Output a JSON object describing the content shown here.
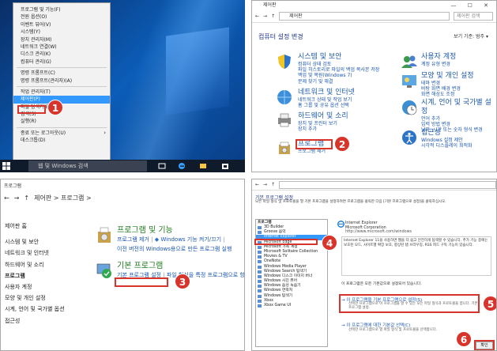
{
  "panel1": {
    "menu": [
      "프로그램 및 기능(F)",
      "전원 옵션(O)",
      "이벤트 뷰어(V)",
      "시스템(Y)",
      "장치 관리자(M)",
      "네트워크 연결(W)",
      "디스크 관리(K)",
      "컴퓨터 관리(G)",
      "명령 프롬프트(C)",
      "명령 프롬프트(관리자)(A)",
      "작업 관리자(T)",
      "제어판(P)",
      "파일 탐색기(E)",
      "검색(S)",
      "실행(R)",
      "종료 또는 로그아웃(U)",
      "데스크톱(D)"
    ],
    "search_text": "웹 및 Windows 검색",
    "step": "1"
  },
  "panel2": {
    "title": "제어판",
    "controls": "— ☐ ✕",
    "path": "제어판",
    "search_placeholder": "제어판 검색",
    "heading": "컴퓨터 설정 변경",
    "view_label": "보기 기준: 범주 ▾",
    "categories": [
      {
        "title": "시스템 및 보안",
        "links": [
          "컴퓨터 상태 검토",
          "파일 히스토리로 파일의 백업 복사본 저장",
          "백업 및 복원(Windows 7)",
          "문제 찾기 및 해결"
        ]
      },
      {
        "title": "네트워크 및 인터넷",
        "links": [
          "네트워크 상태 및 작업 보기",
          "홈 그룹 및 공유 옵션 선택"
        ]
      },
      {
        "title": "하드웨어 및 소리",
        "links": [
          "장치 및 프린터 보기",
          "장치 추가"
        ]
      },
      {
        "title": "프로그램",
        "links": [
          "프로그램 제거"
        ]
      },
      {
        "title": "사용자 계정",
        "links": [
          "계정 유형 변경"
        ]
      },
      {
        "title": "모양 및 개인 설정",
        "links": [
          "테마 변경",
          "바탕 화면 배경 변경",
          "화면 해상도 조정"
        ]
      },
      {
        "title": "시계, 언어 및 국가별 설정",
        "links": [
          "언어 추가",
          "입력 방법 변경",
          "날짜, 시간 또는 숫자 형식 변경"
        ]
      },
      {
        "title": "접근성",
        "links": [
          "Windows 설정 제안",
          "시각적 디스플레이 최적화"
        ]
      }
    ],
    "step": "2"
  },
  "panel3": {
    "title": "프로그램",
    "path": "제어판 > 프로그램 >",
    "sidebar": [
      "제어판 홈",
      "시스템 및 보안",
      "네트워크 및 인터넷",
      "하드웨어 및 소리",
      "프로그램",
      "사용자 계정",
      "모양 및 개인 설정",
      "시계, 언어 및 국가별 옵션",
      "접근성"
    ],
    "group1_title": "프로그램 및 기능",
    "group1_link1": "프로그램 제거",
    "group1_link2": "Windows 기능 켜기/끄기",
    "group1_link3": "이전 버전의 Windows용으로 만든 프로그램 실행",
    "group2_title": "기본 프로그램",
    "group2_link1": "기본 프로그램 설정",
    "group2_link2": "파일 형식을 특정 프로그램으로 항상 열기 설정",
    "step": "3"
  },
  "panel4": {
    "title": "기본 프로그램 설정",
    "desc": "모든 파일 형식 및 프로토콜을 열 기본 프로그램을 설정하려면 프로그램을 클릭한 다음 [기본 프로그램으로 설정]을 클릭하십시오.",
    "list_header": "프로그램",
    "programs": [
      "3D Builder",
      "Groove 음악",
      "Internet Explorer",
      "Microsoft Edge",
      "Microsoft 가족 계정",
      "Microsoft Solitaire Collection",
      "Movies & TV",
      "OneNote",
      "Windows Media Player",
      "Windows Search 탐색기",
      "Windows 디스크 이미지 버너",
      "Windows 사진 뷰어",
      "Windows 음성 녹음기",
      "Windows 연락처",
      "Windows 탐색기",
      "Xbox",
      "Xbox Game UI"
    ],
    "app_name": "Internet Explorer",
    "app_company": "Microsoft Corporation",
    "app_url": "http://www.microsoft.com/windows",
    "app_desc": "Internet Explorer 11을 사용하면 웹을 더 쉽고 안전하게 탐색할 수 있습니다. 추가 기능 중에는 보호된 모드, 사이트별 확장 보호, 향상된 탭 브라우징, RSS 피드 구독 기능이 있습니다.",
    "count": "이 프로그램은 모든 기본값으로 설정되어 있습니다.",
    "opt1": "→ 이 프로그램을 기본 프로그램으로 설정(S)",
    "opt1_desc": "선택한 프로그램으로 이 프로그램을 열 수 있는 모든 파일 형식과 프로토콜을 엽니다. 기본 프로그램 설정.",
    "opt2": "→ 이 프로그램에 대한 기본값 선택(C)",
    "opt2_desc": "선택한 프로그램으로 열 파일 형식 및 프로토콜을 선택합니다.",
    "ok": "확인",
    "step4": "4",
    "step5": "5",
    "step6": "6"
  }
}
